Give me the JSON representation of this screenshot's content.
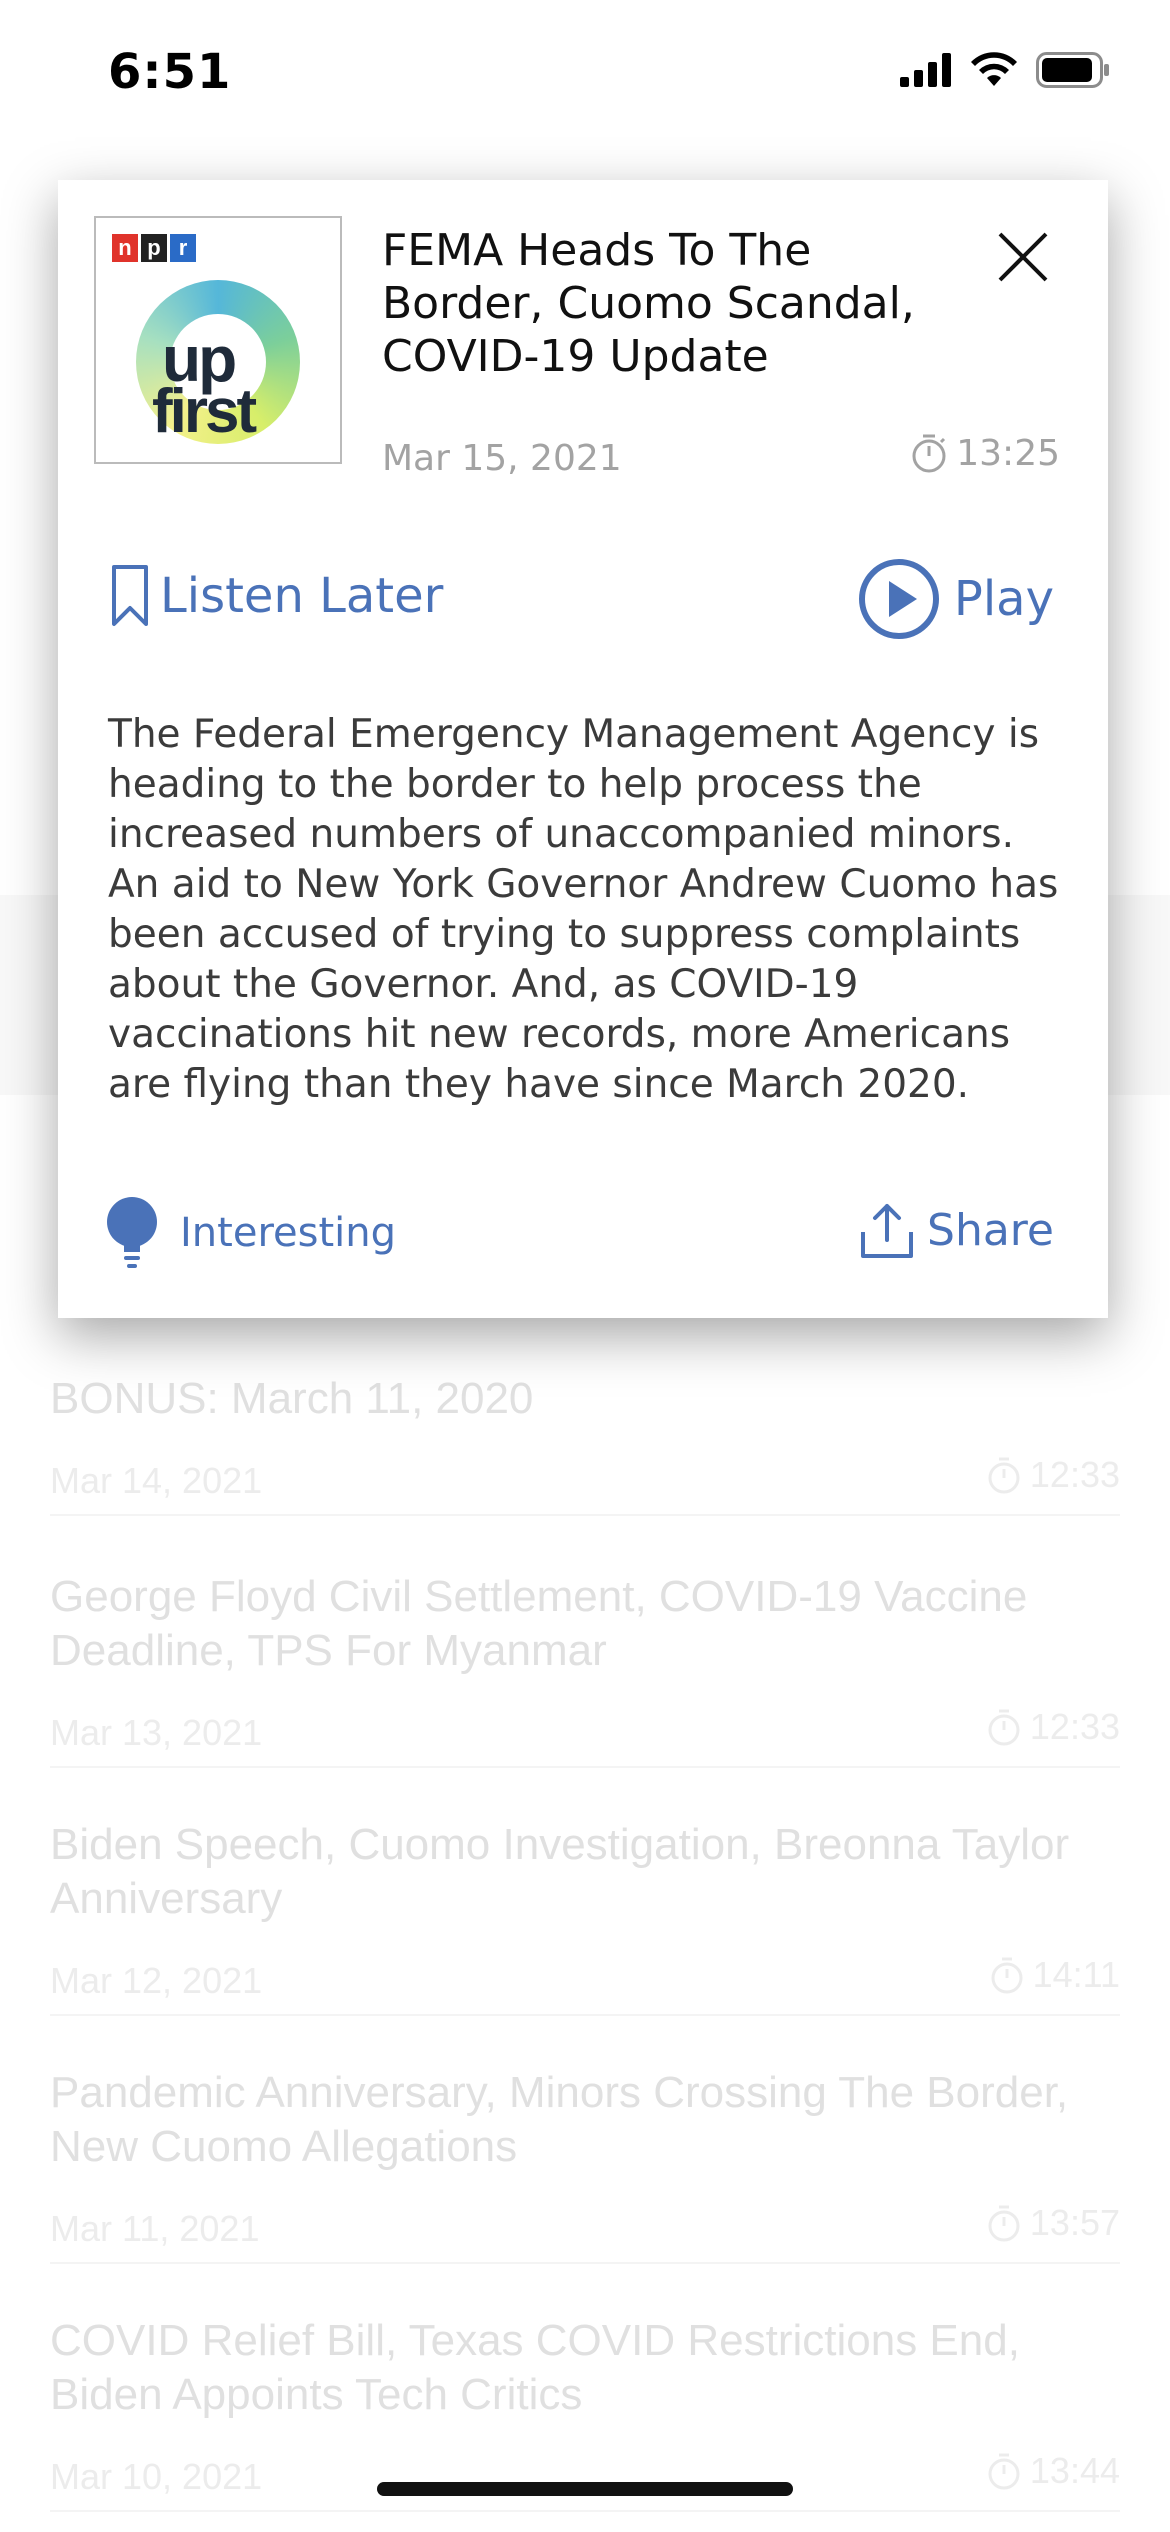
{
  "status_bar": {
    "time": "6:51"
  },
  "popup": {
    "podcast_logo": {
      "brand": [
        "n",
        "p",
        "r"
      ],
      "brand_colors": [
        "#e0332b",
        "#222222",
        "#2a6bc7"
      ],
      "wordmark_top": "up",
      "wordmark_bottom": "first"
    },
    "title": "FEMA Heads To The Border, Cuomo Scandal, COVID-19 Update",
    "date": "Mar 15, 2021",
    "duration": "13:25",
    "listen_later_label": "Listen Later",
    "play_label": "Play",
    "description": "The Federal Emergency Management Agency is heading to the border to help process the increased numbers of unaccompanied minors. An aid to New York Governor Andrew Cuomo has been accused of trying to suppress complaints about the Governor. And, as COVID-19 vaccinations hit new records, more Americans are flying than they have since March 2020.",
    "interesting_label": "Interesting",
    "share_label": "Share",
    "accent_color": "#4a72b8"
  },
  "episodes": [
    {
      "title": "BONUS: March 11, 2020",
      "date": "Mar 14, 2021",
      "duration": "12:33"
    },
    {
      "title": "George Floyd Civil Settlement, COVID-19 Vaccine Deadline, TPS For Myanmar",
      "date": "Mar 13, 2021",
      "duration": "12:33"
    },
    {
      "title": "Biden Speech, Cuomo Investigation, Breonna Taylor Anniversary",
      "date": "Mar 12, 2021",
      "duration": "14:11"
    },
    {
      "title": "Pandemic Anniversary, Minors Crossing The Border, New Cuomo Allegations",
      "date": "Mar 11, 2021",
      "duration": "13:57"
    },
    {
      "title": "COVID Relief Bill, Texas COVID Restrictions End, Biden Appoints Tech Critics",
      "date": "Mar 10, 2021",
      "duration": "13:44"
    }
  ]
}
